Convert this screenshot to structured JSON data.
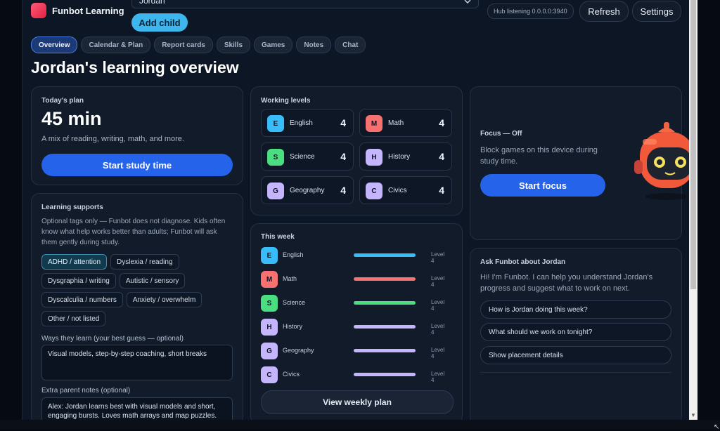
{
  "header": {
    "app_name": "Funbot Learning",
    "child_select_value": "Jordan",
    "add_child_label": "Add child",
    "hub_status": "Hub listening 0.0.0.0:3940",
    "refresh_label": "Refresh",
    "settings_label": "Settings"
  },
  "tabs": [
    {
      "label": "Overview",
      "active": true
    },
    {
      "label": "Calendar & Plan"
    },
    {
      "label": "Report cards"
    },
    {
      "label": "Skills"
    },
    {
      "label": "Games"
    },
    {
      "label": "Notes"
    },
    {
      "label": "Chat"
    }
  ],
  "page_title": "Jordan's learning overview",
  "today_plan": {
    "title": "Today's plan",
    "minutes": "45 min",
    "description": "A mix of reading, writing, math, and more.",
    "button_label": "Start study time"
  },
  "supports": {
    "title": "Learning supports",
    "description": "Optional tags only — Funbot does not diagnose. Kids often know what help works better than adults; Funbot will ask them gently during study.",
    "chips": [
      {
        "label": "ADHD / attention",
        "selected": true
      },
      {
        "label": "Dyslexia / reading"
      },
      {
        "label": "Dysgraphia / writing"
      },
      {
        "label": "Autistic / sensory"
      },
      {
        "label": "Dyscalculia / numbers"
      },
      {
        "label": "Anxiety / overwhelm"
      },
      {
        "label": "Other / not listed"
      }
    ],
    "ways_label": "Ways they learn (your best guess — optional)",
    "ways_value": "Visual models, step-by-step coaching, short breaks",
    "notes_label": "Extra parent notes (optional)",
    "notes_value": "Alex: Jordan learns best with visual models and short, engaging bursts. Loves math arrays and map puzzles."
  },
  "working_levels": {
    "title": "Working levels",
    "items": [
      {
        "letter": "E",
        "subject": "English",
        "level": "4",
        "color": "#38bdf8"
      },
      {
        "letter": "M",
        "subject": "Math",
        "level": "4",
        "color": "#f87171"
      },
      {
        "letter": "S",
        "subject": "Science",
        "level": "4",
        "color": "#4ade80"
      },
      {
        "letter": "H",
        "subject": "History",
        "level": "4",
        "color": "#c4b5fd"
      },
      {
        "letter": "G",
        "subject": "Geography",
        "level": "4",
        "color": "#c4b5fd"
      },
      {
        "letter": "C",
        "subject": "Civics",
        "level": "4",
        "color": "#c4b5fd"
      }
    ]
  },
  "this_week": {
    "title": "This week",
    "rows": [
      {
        "letter": "E",
        "subject": "English",
        "level_text": "Level 4",
        "color": "#38bdf8",
        "bar_color": "#38bdf8"
      },
      {
        "letter": "M",
        "subject": "Math",
        "level_text": "Level 4",
        "color": "#f87171",
        "bar_color": "#f87171"
      },
      {
        "letter": "S",
        "subject": "Science",
        "level_text": "Level 4",
        "color": "#4ade80",
        "bar_color": "#4ade80"
      },
      {
        "letter": "H",
        "subject": "History",
        "level_text": "Level 4",
        "color": "#c4b5fd",
        "bar_color": "#c4b5fd"
      },
      {
        "letter": "G",
        "subject": "Geography",
        "level_text": "Level 4",
        "color": "#c4b5fd",
        "bar_color": "#c4b5fd"
      },
      {
        "letter": "C",
        "subject": "Civics",
        "level_text": "Level 4",
        "color": "#c4b5fd",
        "bar_color": "#c4b5fd"
      }
    ],
    "button_label": "View weekly plan"
  },
  "focus": {
    "title": "Focus — Off",
    "description": "Block games on this device during study time.",
    "button_label": "Start focus",
    "robot_icon": "funbot-robot-icon"
  },
  "ask": {
    "title": "Ask Funbot about Jordan",
    "description": "Hi! I'm Funbot. I can help you understand Jordan's progress and suggest what to work on next.",
    "suggestions": [
      "How is Jordan doing this week?",
      "What should we work on tonight?",
      "Show placement details"
    ]
  },
  "colors": {
    "accent": "#2563eb",
    "add_child": "#3db6ee",
    "background": "#0d1624"
  }
}
